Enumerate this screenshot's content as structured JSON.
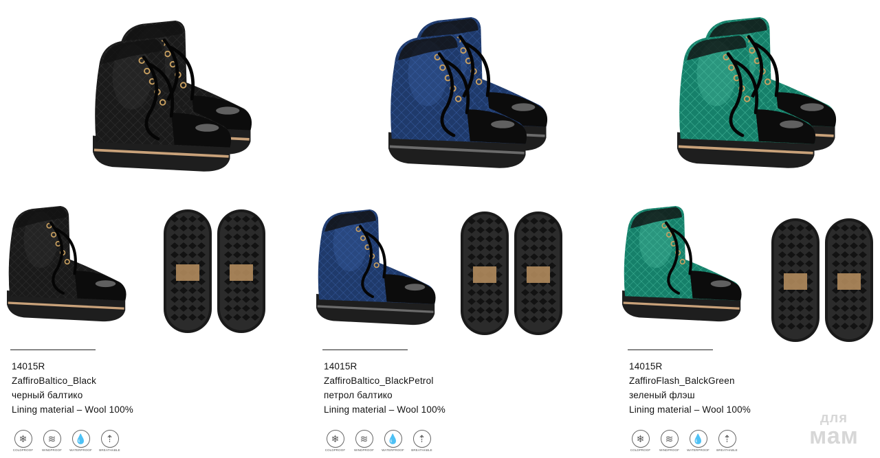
{
  "products": [
    {
      "code": "14015R",
      "model": "ZaffiroBaltico_Black",
      "color_name": "черный балтико",
      "lining": "Lining material – Wool 100%",
      "upper_color": "#1a1a1a",
      "upper_shine": "#3a3a3a",
      "sole_stripe": "#c9a27a"
    },
    {
      "code": "14015R",
      "model": "ZaffiroBaltico_BlackPetrol",
      "color_name": "петрол балтико",
      "lining": "Lining material – Wool 100%",
      "upper_color": "#1f3a6b",
      "upper_shine": "#3d63a8",
      "sole_stripe": "#6b6b6b"
    },
    {
      "code": "14015R",
      "model": "ZaffiroFlash_BalckGreen",
      "color_name": "зеленый флэш",
      "lining": "Lining material – Wool 100%",
      "upper_color": "#16806a",
      "upper_shine": "#4fc1a4",
      "sole_stripe": "#c9a27a"
    }
  ],
  "features": [
    {
      "icon": "snowflake-icon",
      "glyph": "❄",
      "caption": "COLDPROOF"
    },
    {
      "icon": "wind-icon",
      "glyph": "≋",
      "caption": "WINDPROOF"
    },
    {
      "icon": "water-drop-icon",
      "glyph": "💧",
      "caption": "WATERPROOF"
    },
    {
      "icon": "breathable-icon",
      "glyph": "⇡",
      "caption": "BREATHABLE"
    }
  ],
  "watermark": {
    "line1": "для",
    "line2": "мам"
  }
}
